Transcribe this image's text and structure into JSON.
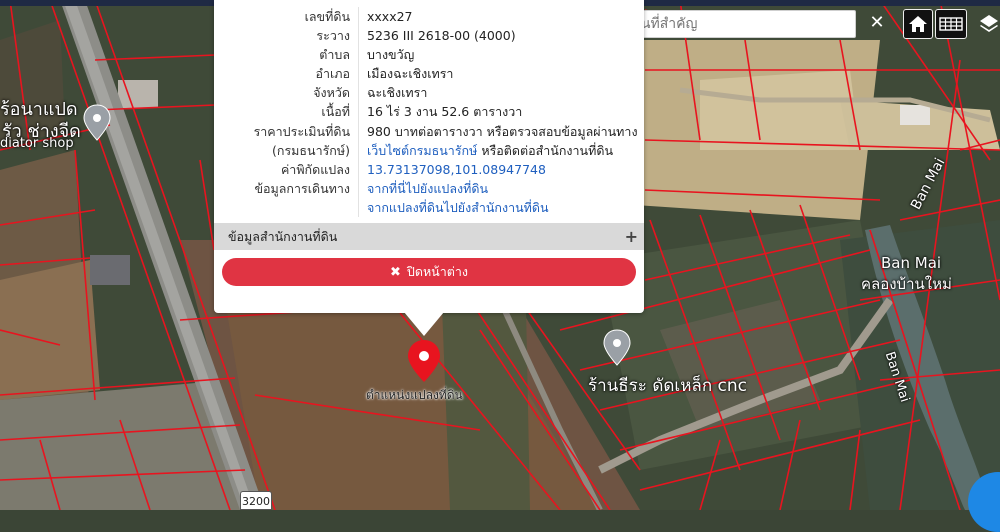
{
  "search": {
    "placeholder": "ค้นหาสถานที่สำคัญ"
  },
  "icons": {
    "clear": "close-icon",
    "home": "home-icon",
    "grid": "grid-icon",
    "layers": "layers-icon",
    "pin": "map-pin-icon"
  },
  "colors": {
    "parcel_line": "#e8141f",
    "pin": "#e8141f",
    "close_button": "#e03443",
    "link": "#1f5fbf"
  },
  "popup": {
    "rows": [
      {
        "label": "เลขที่ดิน",
        "value": "xxxx27"
      },
      {
        "label": "ระวาง",
        "value": "5236 III 2618-00 (4000)"
      },
      {
        "label": "ตำบล",
        "value": "บางขวัญ"
      },
      {
        "label": "อำเภอ",
        "value": "เมืองฉะเชิงเทรา"
      },
      {
        "label": "จังหวัด",
        "value": "ฉะเชิงเทรา"
      },
      {
        "label": "เนื้อที่",
        "value": "16 ไร่ 3 งาน 52.6 ตารางวา"
      },
      {
        "label": "ราคาประเมินที่ดิน",
        "value": "980 บาทต่อตารางวา หรือตรวจสอบข้อมูลผ่านทาง"
      }
    ],
    "dept_label": "(กรมธนารักษ์)",
    "dept_link": "เว็บไซต์กรมธนารักษ์",
    "dept_suffix": " หรือติดต่อสำนักงานที่ดิน",
    "coord_label": "ค่าพิกัดแปลง",
    "coord_value": "13.73137098,101.08947748",
    "travel_label": "ข้อมูลการเดินทาง",
    "travel_link_1": "จากที่นี่ไปยังแปลงที่ดิน",
    "travel_link_2": "จากแปลงที่ดินไปยังสำนักงานที่ดิน",
    "accordion_label": "ข้อมูลสำนักงานที่ดิน",
    "close_label": "ปิดหน้าต่าง"
  },
  "map": {
    "pin_label": "ตำแหน่งแปลงที่ดิน",
    "labels": [
      {
        "id": "label-shop-left-1",
        "text": "ร้อนาแปด"
      },
      {
        "id": "label-shop-left-2",
        "text": "รัว ช่างจีด"
      },
      {
        "id": "label-shop-left-3",
        "text": "diator shop"
      },
      {
        "id": "label-ban-mai-diag",
        "text": "Ban Mai"
      },
      {
        "id": "label-ban-mai",
        "text": "Ban Mai"
      },
      {
        "id": "label-khlong",
        "text": "คลองบ้านใหม่"
      },
      {
        "id": "label-ban-mai-vert",
        "text": "Ban Mai"
      },
      {
        "id": "label-shop-cnc",
        "text": "ร้านธีระ ดัดเหล็ก cnc"
      }
    ],
    "road_number": "3200"
  }
}
